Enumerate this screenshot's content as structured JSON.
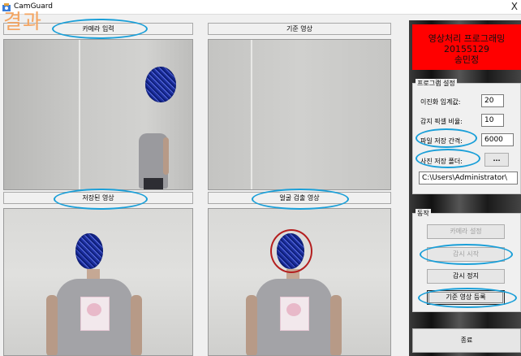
{
  "window": {
    "title": "CamGuard",
    "close_glyph": "X",
    "icon": "camera-app-icon"
  },
  "overlay_label": "결과",
  "panels": {
    "camera_input": "카메라 입력",
    "reference_image": "기준 영상",
    "saved_image": "저장된 영상",
    "face_detect_image": "얼굴 검출 영상"
  },
  "banner": {
    "line1": "영상처리 프로그래밍",
    "line2": "20155129",
    "line3": "송민정",
    "color": "#ff0000"
  },
  "settings": {
    "title": "프로그램 설정",
    "binary_threshold_label": "이진화 임계값:",
    "binary_threshold_value": "20",
    "pixel_ratio_label": "감지 픽셀 비율:",
    "pixel_ratio_value": "10",
    "file_interval_label": "파일 저장 간격:",
    "file_interval_value": "6000",
    "photo_folder_label": "사진 저장 폴더:",
    "browse_label": "...",
    "folder_path": "C:\\Users\\Administrator\\"
  },
  "actions": {
    "title": "동작",
    "camera_settings": "카메라 설정",
    "start_monitor": "감시 시작",
    "stop_monitor": "감시 정지",
    "register_reference": "기준 영상 등록",
    "exit": "종료"
  },
  "colors": {
    "highlight": "#1a9fd8",
    "face_circle": "#b41f1f",
    "overlay_text": "#f4a460"
  }
}
